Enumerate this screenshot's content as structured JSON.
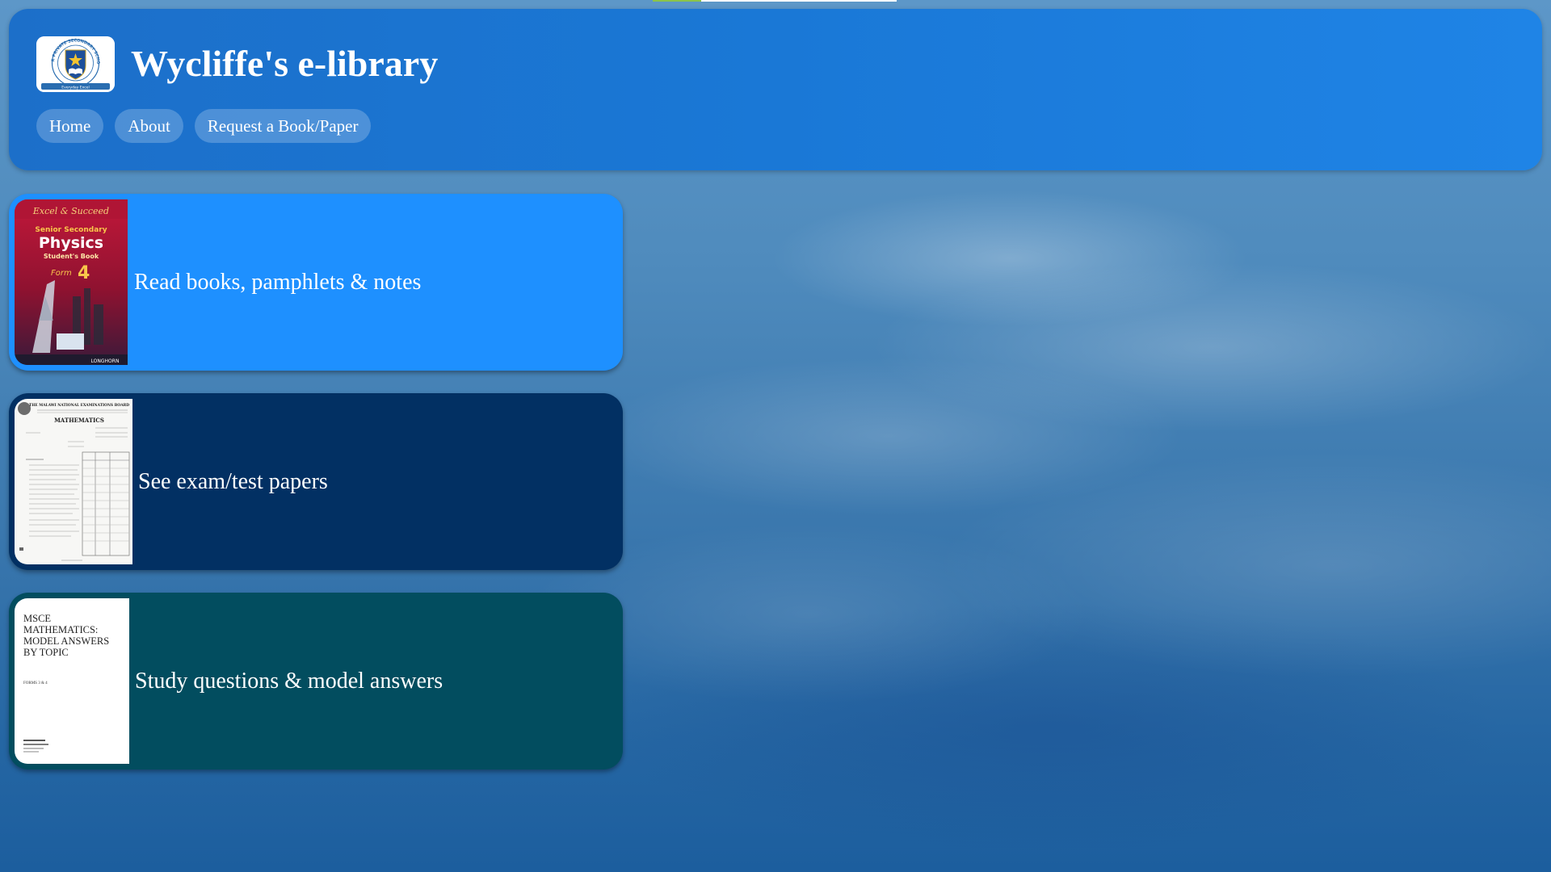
{
  "header": {
    "title": "Wycliffe's e-library",
    "logo": {
      "icon": "school-crest-icon",
      "ring_text": "STAR PRIVATE SECONDARY SCHOOL",
      "motto": "Everyday Excel"
    },
    "nav": [
      {
        "label": "Home"
      },
      {
        "label": "About"
      },
      {
        "label": "Request a Book/Paper"
      }
    ]
  },
  "cards": [
    {
      "label": "Read books, pamphlets & notes",
      "color": "#1e90ff",
      "thumb": {
        "series": "Excel & Succeed",
        "level": "Senior Secondary",
        "subject": "Physics",
        "type": "Student's Book",
        "form_word": "Form",
        "form_number": "4",
        "publisher": "LONGHORN"
      }
    },
    {
      "label": "See exam/test papers",
      "color": "#023063",
      "thumb": {
        "board": "THE MALAWI NATIONAL EXAMINATIONS BOARD",
        "subject": "MATHEMATICS"
      }
    },
    {
      "label": "Study questions & model answers",
      "color": "#024d5f",
      "thumb": {
        "title_lines": [
          "MSCE",
          "MATHEMATICS:",
          "MODEL ANSWERS",
          "BY TOPIC"
        ],
        "forms": "FORMS 3 & 4"
      }
    }
  ],
  "colors": {
    "header_bg": "#1a78d6",
    "page_bg": "#4f8bbd",
    "loading_bar": "#ffffff",
    "loading_accent": "#8bc34a"
  }
}
